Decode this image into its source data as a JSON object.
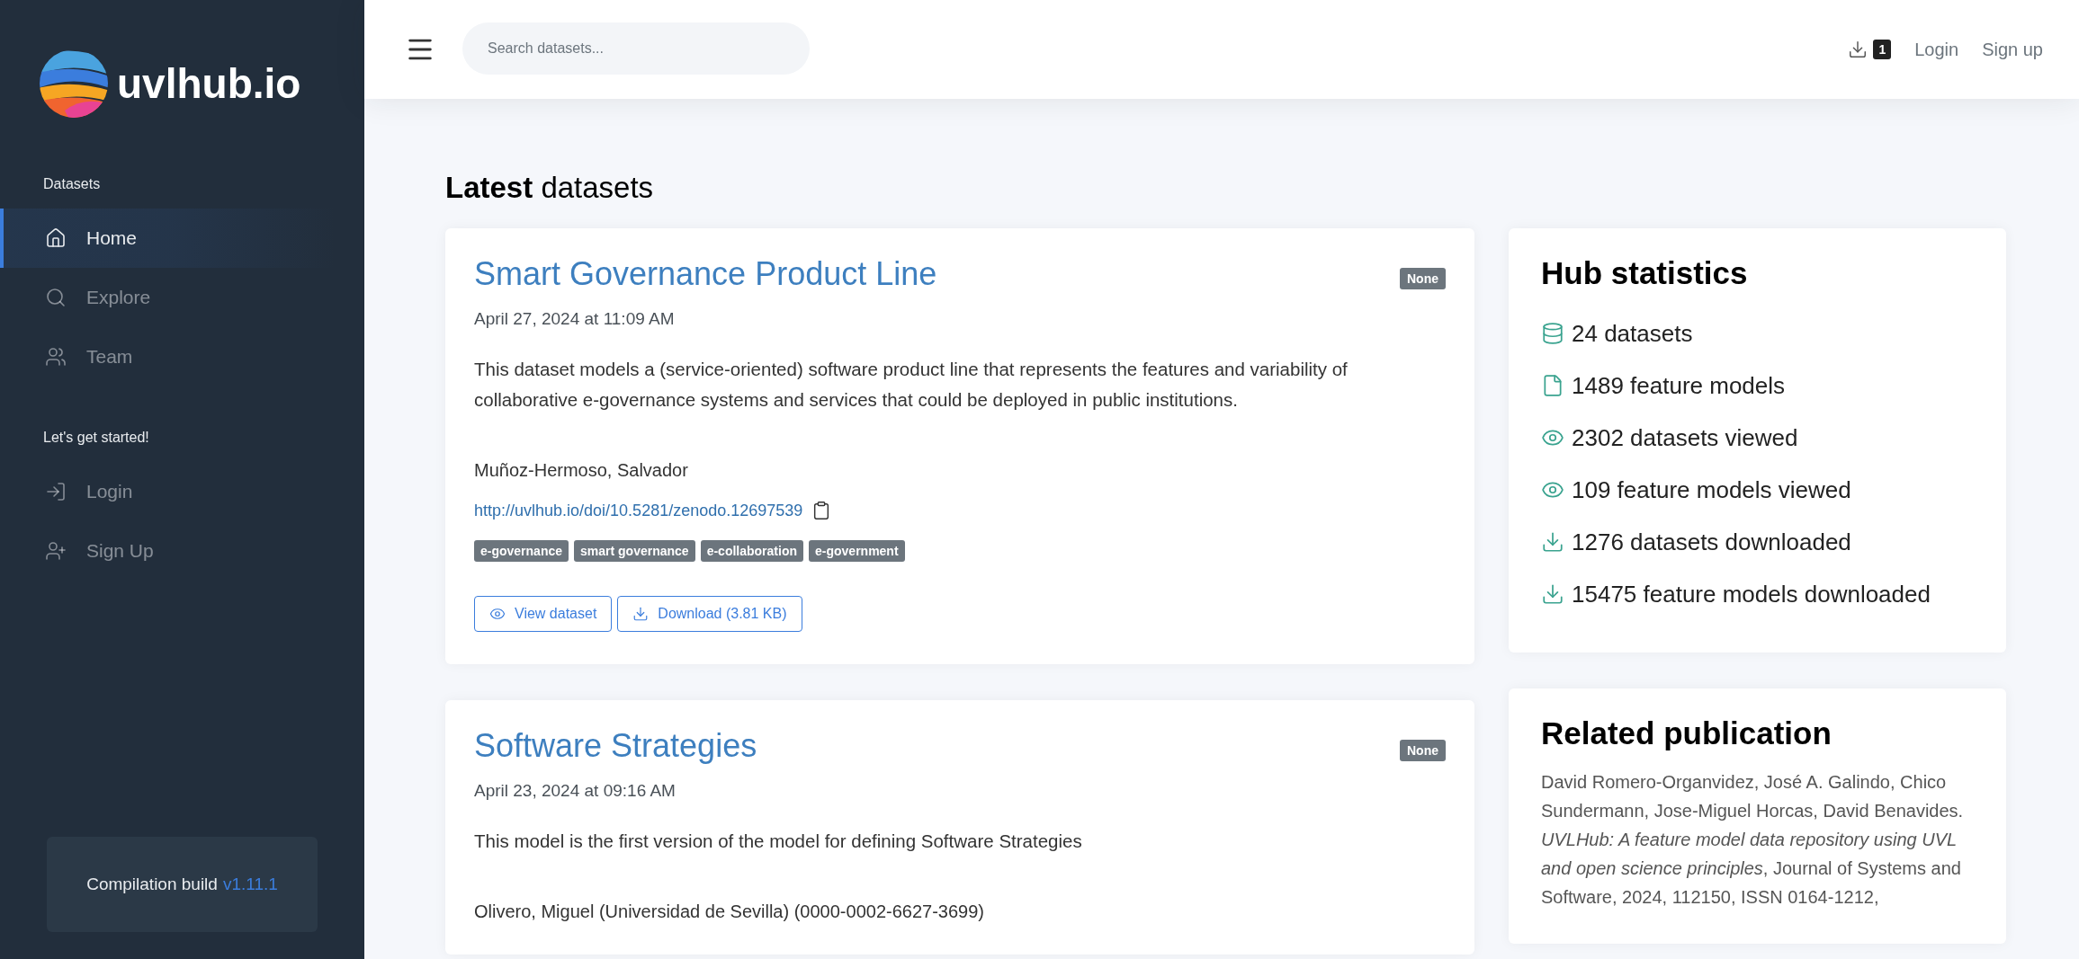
{
  "brand": {
    "name": "uvlhub.io"
  },
  "sidebar": {
    "sections": [
      {
        "heading": "Datasets",
        "items": [
          {
            "label": "Home",
            "kind": "home",
            "selected": true
          },
          {
            "label": "Explore",
            "kind": "search",
            "selected": false
          },
          {
            "label": "Team",
            "kind": "users",
            "selected": false
          }
        ]
      },
      {
        "heading": "Let's get started!",
        "items": [
          {
            "label": "Login",
            "kind": "login",
            "selected": false
          },
          {
            "label": "Sign Up",
            "kind": "signup",
            "selected": false
          }
        ]
      }
    ],
    "build": {
      "label": "Compilation build",
      "version": "v1.11.1"
    }
  },
  "topbar": {
    "search": {
      "placeholder": "Search datasets..."
    },
    "download_count": "1",
    "links": [
      "Login",
      "Sign up"
    ]
  },
  "main": {
    "heading_bold": "Latest",
    "heading_rest": "datasets",
    "datasets": [
      {
        "title": "Smart Governance Product Line",
        "badge": "None",
        "date": "April 27, 2024 at 11:09 AM",
        "description": "This dataset models a (service-oriented) software product line that represents the features and variability of collaborative e-governance systems and services that could be deployed in public institutions.",
        "authors": "Muñoz-Hermoso, Salvador",
        "doi": "http://uvlhub.io/doi/10.5281/zenodo.12697539",
        "tags": [
          "e-governance",
          "smart governance",
          "e-collaboration",
          "e-government"
        ],
        "buttons": [
          {
            "label": "View dataset",
            "kind": "eye"
          },
          {
            "label": "Download (3.81 KB)",
            "kind": "download"
          }
        ]
      },
      {
        "title": "Software Strategies",
        "badge": "None",
        "date": "April 23, 2024 at 09:16 AM",
        "description": "This model is the first version of the model for defining Software Strategies",
        "authors": "Olivero, Miguel (Universidad de Sevilla) (0000-0002-6627-3699)"
      }
    ]
  },
  "stats": {
    "title": "Hub statistics",
    "items": [
      {
        "kind": "database",
        "text": "24 datasets"
      },
      {
        "kind": "file",
        "text": "1489 feature models"
      },
      {
        "kind": "eye",
        "text": "2302 datasets viewed"
      },
      {
        "kind": "eye",
        "text": "109 feature models viewed"
      },
      {
        "kind": "download",
        "text": "1276 datasets downloaded"
      },
      {
        "kind": "download",
        "text": "15475 feature models downloaded"
      }
    ]
  },
  "publication": {
    "title": "Related publication",
    "text": "David Romero-Organvidez, José A. Galindo, Chico Sundermann, Jose-Miguel Horcas, David Benavides. *UVLHub: A feature model data repository using UVL and open science principles*, Journal of Systems and Software, 2024, 112150, ISSN 0164-1212,"
  }
}
